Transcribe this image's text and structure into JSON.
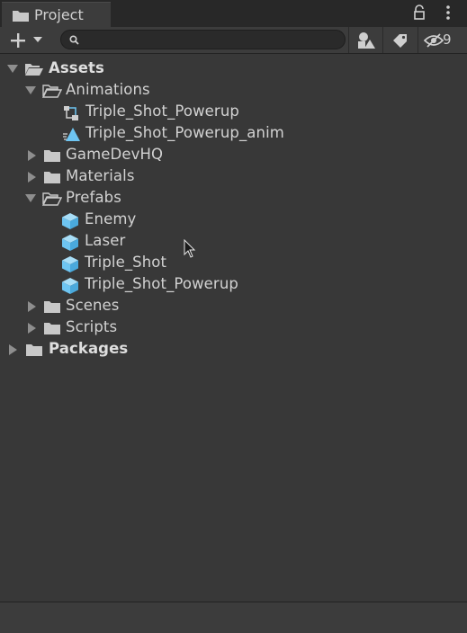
{
  "window": {
    "tab_title": "Project",
    "search": {
      "value": "",
      "placeholder": ""
    },
    "hidden_packages_count": "9"
  },
  "tree": [
    {
      "label": "Assets",
      "bold": true,
      "expanded": true,
      "icon": "folder-open-icon"
    },
    {
      "label": "Animations",
      "bold": false,
      "expanded": true,
      "icon": "folder-open-icon"
    },
    {
      "label": "Triple_Shot_Powerup",
      "bold": false,
      "icon": "animator-controller-icon"
    },
    {
      "label": "Triple_Shot_Powerup_anim",
      "bold": false,
      "icon": "animation-clip-icon"
    },
    {
      "label": "GameDevHQ",
      "bold": false,
      "expanded": false,
      "icon": "folder-icon"
    },
    {
      "label": "Materials",
      "bold": false,
      "expanded": false,
      "icon": "folder-icon"
    },
    {
      "label": "Prefabs",
      "bold": false,
      "expanded": true,
      "icon": "folder-open-icon"
    },
    {
      "label": "Enemy",
      "bold": false,
      "icon": "prefab-icon"
    },
    {
      "label": "Laser",
      "bold": false,
      "icon": "prefab-icon"
    },
    {
      "label": "Triple_Shot",
      "bold": false,
      "icon": "prefab-icon"
    },
    {
      "label": "Triple_Shot_Powerup",
      "bold": false,
      "icon": "prefab-icon"
    },
    {
      "label": "Scenes",
      "bold": false,
      "expanded": false,
      "icon": "folder-icon"
    },
    {
      "label": "Scripts",
      "bold": false,
      "expanded": false,
      "icon": "folder-icon"
    },
    {
      "label": "Packages",
      "bold": true,
      "expanded": false,
      "icon": "folder-icon"
    }
  ],
  "colors": {
    "background": "#383838",
    "prefab_blue": "#6ec5f2",
    "text": "#d2d2d2"
  }
}
